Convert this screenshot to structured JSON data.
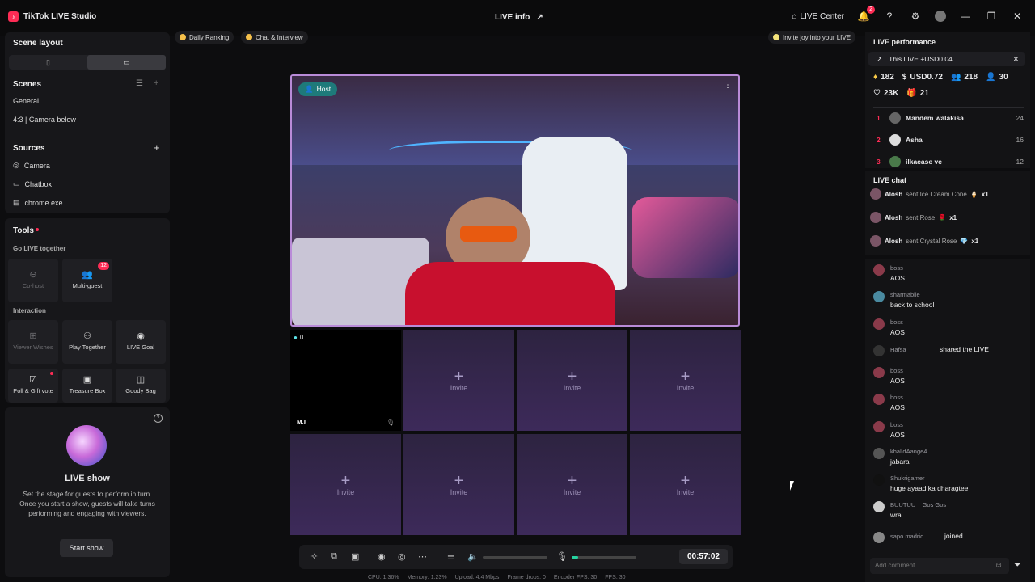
{
  "titlebar": {
    "app_name": "TikTok LIVE Studio",
    "center_title": "LIVE info",
    "live_center": "LIVE Center",
    "notif_count": "2"
  },
  "left": {
    "scene_layout": "Scene layout",
    "scenes": {
      "title": "Scenes",
      "items": [
        "General",
        "4:3 | Camera below"
      ]
    },
    "sources": {
      "title": "Sources",
      "items": [
        "Camera",
        "Chatbox",
        "chrome.exe"
      ]
    },
    "tools": {
      "title": "Tools",
      "go_live_together": "Go LIVE together",
      "cohost": "Co-host",
      "multiguest": "Multi-guest",
      "multiguest_badge": "12",
      "interaction": "Interaction",
      "viewer_wishes": "Viewer Wishes",
      "play_together": "Play Together",
      "live_goal": "LIVE Goal",
      "poll_gift_vote": "Poll & Gift vote",
      "treasure_box": "Treasure Box",
      "goody_bag": "Goody Bag"
    },
    "live_show": {
      "title": "LIVE show",
      "desc": "Set the stage for guests to perform in turn. Once you start a show, guests will take turns performing and engaging with viewers.",
      "start": "Start show"
    }
  },
  "top_pills": {
    "daily_ranking": "Daily Ranking",
    "chat_interview": "Chat & Interview",
    "invite_joy": "Invite joy into your LIVE"
  },
  "stage": {
    "host_label": "Host",
    "guest_name": "MJ",
    "guest_count": "0",
    "invite_label": "Invite"
  },
  "controls": {
    "timer": "00:57:02",
    "volume_level": 0.0,
    "mic_level": 0.1
  },
  "stats": {
    "cpu": "CPU: 1.36%",
    "memory": "Memory: 1.23%",
    "upload": "Upload: 4.4 Mbps",
    "frame_drops": "Frame drops: 0",
    "encoder_fps": "Encoder FPS: 30",
    "fps": "FPS: 30"
  },
  "right": {
    "performance_title": "LIVE performance",
    "this_live": "This LIVE +USD0.04",
    "diamonds": "182",
    "usd": "USD0.72",
    "viewers": "218",
    "new_followers": "30",
    "likes": "23K",
    "gifters": "21",
    "ranking": [
      {
        "n": "1",
        "name": "Mandem walakisa",
        "score": "24"
      },
      {
        "n": "2",
        "name": "Asha",
        "score": "16"
      },
      {
        "n": "3",
        "name": "ilkacase vc",
        "score": "12"
      }
    ],
    "chat_title": "LIVE chat",
    "gifts": [
      {
        "user": "Alosh",
        "text": "sent Ice Cream Cone",
        "count": "x1"
      },
      {
        "user": "Alosh",
        "text": "sent Rose",
        "count": "x1"
      },
      {
        "user": "Alosh",
        "text": "sent Crystal Rose",
        "count": "x1"
      }
    ],
    "messages": [
      {
        "user": "boss",
        "msg": "AOS"
      },
      {
        "user": "sharmabile",
        "msg": "back to school"
      },
      {
        "user": "boss",
        "msg": "AOS"
      },
      {
        "user": "Hafsa",
        "msg": "shared the LIVE"
      },
      {
        "user": "boss",
        "msg": "AOS"
      },
      {
        "user": "boss",
        "msg": "AOS"
      },
      {
        "user": "boss",
        "msg": "AOS"
      },
      {
        "user": "khalidAange4",
        "msg": "jabara"
      },
      {
        "user": "Shukrigamer",
        "msg": "huge ayaad ka dharagtee"
      },
      {
        "user": "BUUTUU__Gos Gos",
        "msg": "wra"
      },
      {
        "user": "sapo madrid",
        "msg": "joined"
      }
    ],
    "add_comment": "Add comment"
  }
}
